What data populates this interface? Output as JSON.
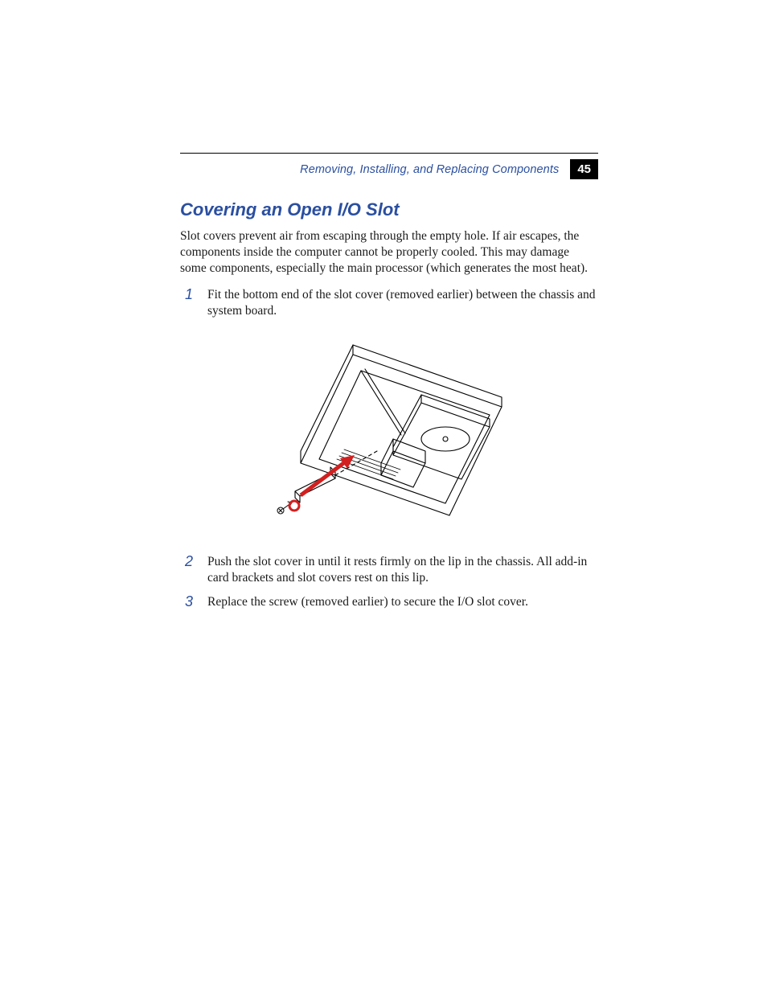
{
  "header": {
    "running_title": "Removing, Installing, and Replacing Components",
    "page_number": "45"
  },
  "section": {
    "title": "Covering an Open I/O Slot",
    "intro": "Slot covers prevent air from escaping through the empty hole. If air escapes, the components inside the computer cannot be properly cooled. This may damage some components, especially the main processor (which generates the most heat).",
    "steps": [
      "Fit the bottom end of the slot cover (removed earlier) between the chassis and system board.",
      "Push the slot cover in until it rests firmly on the lip in the chassis. All add-in card brackets and slot covers rest on this lip.",
      "Replace the screw (removed earlier) to secure the I/O slot cover."
    ]
  },
  "figure": {
    "alt": "Isometric line drawing of open computer chassis showing system board, drive, heatsink, and red arrow indicating insertion of I/O slot cover with screw."
  }
}
